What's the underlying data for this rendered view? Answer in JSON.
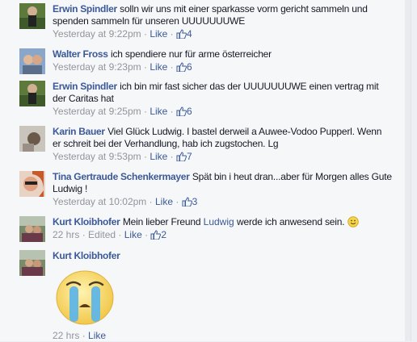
{
  "comments": [
    {
      "name": "Erwin Spindler",
      "text": "solln wir uns mit einer sparkasse vorm gericht sammeln und spenden sammeln für unseren UUUUUUUWE",
      "time": "Yesterday at 9:22pm",
      "like_label": "Like",
      "likes": "4"
    },
    {
      "name": "Walter Fross",
      "text": "ich spendiere nur für arme österreicher",
      "time": "Yesterday at 9:23pm",
      "like_label": "Like",
      "likes": "6"
    },
    {
      "name": "Erwin Spindler",
      "text": "ich bin mir fast sicher das der UUUUUUUWE einen vertrag mit der Caritas hat",
      "time": "Yesterday at 9:25pm",
      "like_label": "Like",
      "likes": "6"
    },
    {
      "name": "Karin Bauer",
      "text": "Viel Glück Ludwig. I bastel derweil a Auwee-Vodoo Pupperl. Wenn er schreit bei der Verhandlung, hab ich zugstochen. Lg",
      "time": "Yesterday at 9:53pm",
      "like_label": "Like",
      "likes": "7"
    },
    {
      "name": "Tina Gertraude Schenkermayer",
      "text": "Spät bin i heut dran...aber für Morgen alles Gute Ludwig !",
      "time": "Yesterday at 10:02pm",
      "like_label": "Like",
      "likes": "3"
    },
    {
      "name": "Kurt Kloibhofer",
      "text_before": "Mein lieber Freund",
      "link": "Ludwig",
      "text_after": "werde ich anwesend sein.",
      "time": "22 hrs",
      "edited": "Edited",
      "like_label": "Like",
      "likes": "2"
    },
    {
      "name": "Kurt Kloibhofer",
      "time": "22 hrs",
      "like_label": "Like"
    }
  ],
  "separator": " · ",
  "icons": {
    "like": "thumbs-up-icon",
    "smile": "smile-emoji-icon",
    "cry": "crying-emoji-sticker"
  },
  "colors": {
    "name": "#3b5998",
    "meta": "#90949c",
    "bg": "#f6f7f9"
  }
}
